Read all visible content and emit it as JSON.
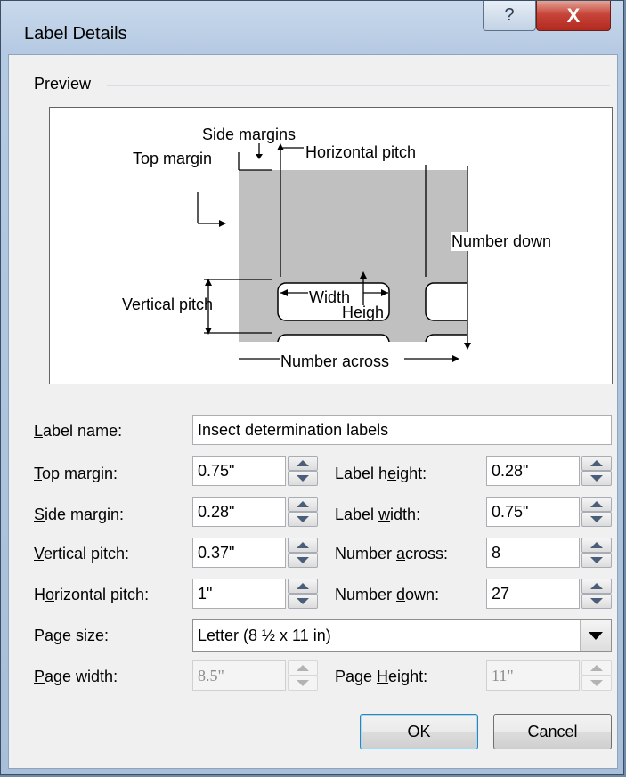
{
  "dialog": {
    "title": "Label Details",
    "help_glyph": "?",
    "close_glyph": "X"
  },
  "preview": {
    "group_label": "Preview",
    "diagram": {
      "side_margins": "Side margins",
      "top_margin": "Top margin",
      "horizontal_pitch": "Horizontal pitch",
      "number_down": "Number down",
      "vertical_pitch": "Vertical pitch",
      "width": "Width",
      "height": "Heigh",
      "number_across": "Number across"
    }
  },
  "form": {
    "label_name": {
      "label_pre": "",
      "label_key": "L",
      "label_post": "abel name:",
      "value": "Insect determination labels"
    },
    "top_margin": {
      "label_key": "T",
      "label_post": "op margin:",
      "value": "0.75\""
    },
    "side_margin": {
      "label_key": "S",
      "label_post": "ide margin:",
      "value": "0.28\""
    },
    "vertical_pitch": {
      "label_key": "V",
      "label_post": "ertical pitch:",
      "value": "0.37\""
    },
    "horizontal_pitch": {
      "label_pre": "H",
      "label_key": "o",
      "label_post": "rizontal pitch:",
      "value": "1\""
    },
    "label_height": {
      "label_pre": "Label h",
      "label_key": "e",
      "label_post": "ight:",
      "value": "0.28\""
    },
    "label_width": {
      "label_pre": "Label ",
      "label_key": "w",
      "label_post": "idth:",
      "value": "0.75\""
    },
    "number_across": {
      "label_pre": "Number ",
      "label_key": "a",
      "label_post": "cross:",
      "value": "8"
    },
    "number_down": {
      "label_pre": "Number ",
      "label_key": "d",
      "label_post": "own:",
      "value": "27"
    },
    "page_size": {
      "label": "Page size:",
      "value": "Letter (8 ½ x 11 in)"
    },
    "page_width": {
      "label_key": "P",
      "label_post": "age width:",
      "value": "8.5\""
    },
    "page_height": {
      "label_pre": "Page ",
      "label_key": "H",
      "label_post": "eight:",
      "value": "11\""
    }
  },
  "buttons": {
    "ok": "OK",
    "cancel": "Cancel"
  },
  "icons": {
    "spin_up": "triangle-up",
    "spin_down": "triangle-down",
    "dropdown": "triangle-down"
  }
}
